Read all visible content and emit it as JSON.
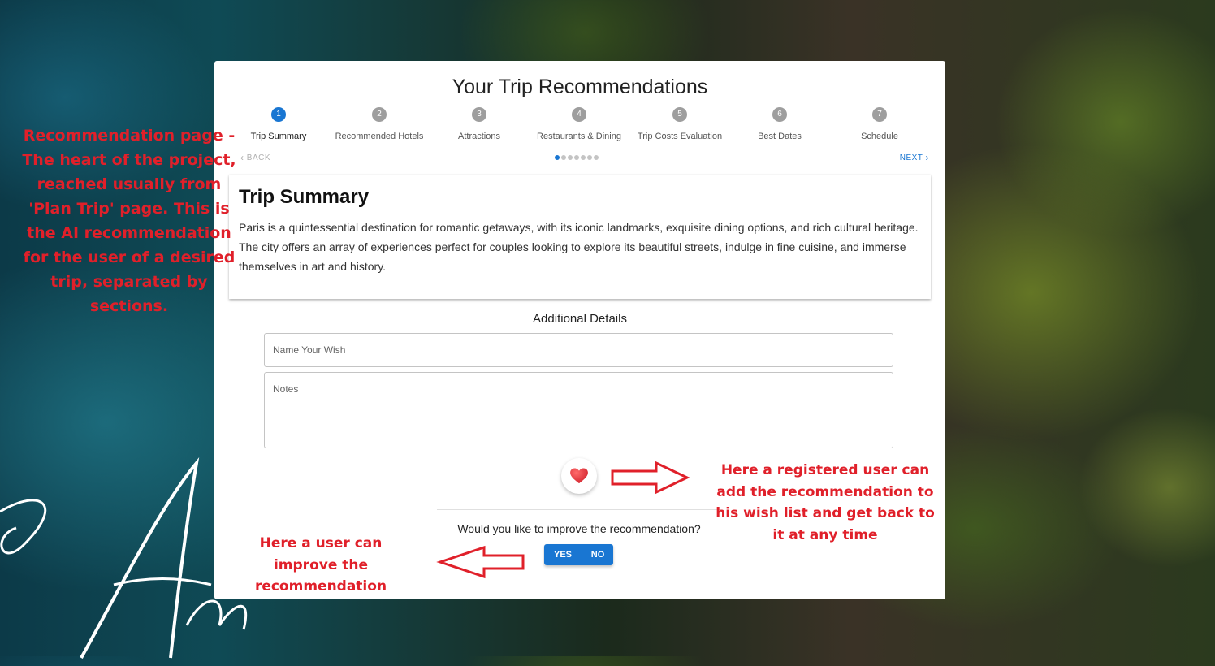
{
  "header": {
    "title": "Your Trip Recommendations"
  },
  "stepper": {
    "active_step": 1,
    "steps": [
      {
        "number": "1",
        "label": "Trip Summary"
      },
      {
        "number": "2",
        "label": "Recommended Hotels"
      },
      {
        "number": "3",
        "label": "Attractions"
      },
      {
        "number": "4",
        "label": "Restaurants & Dining"
      },
      {
        "number": "5",
        "label": "Trip Costs Evaluation"
      },
      {
        "number": "6",
        "label": "Best Dates"
      },
      {
        "number": "7",
        "label": "Schedule"
      }
    ],
    "back_label": "BACK",
    "next_label": "NEXT"
  },
  "summary": {
    "title": "Trip Summary",
    "text": "Paris is a quintessential destination for romantic getaways, with its iconic landmarks, exquisite dining options, and rich cultural heritage. The city offers an array of experiences perfect for couples looking to explore its beautiful streets, indulge in fine cuisine, and immerse themselves in art and history."
  },
  "details": {
    "heading": "Additional Details",
    "wish_name": {
      "placeholder": "Name Your Wish",
      "value": ""
    },
    "notes": {
      "placeholder": "Notes",
      "value": ""
    }
  },
  "improve": {
    "question": "Would you like to improve the recommendation?",
    "yes_label": "YES",
    "no_label": "NO"
  },
  "annotations": {
    "left": "Recommendation page - The heart of the project, reached usually from 'Plan Trip' page. This is the AI recommendation for the user of a desired trip, separated by sections.",
    "right": "Here a registered user can add the recommendation to his wish list and get back to it at any time",
    "bottom": "Here a user can improve the recommendation"
  },
  "colors": {
    "primary": "#1976d2",
    "annotation": "#e0202a",
    "heart": "#e53935"
  },
  "icons": {
    "favorite": "heart-icon",
    "back": "chevron-left-icon",
    "next": "chevron-right-icon"
  }
}
